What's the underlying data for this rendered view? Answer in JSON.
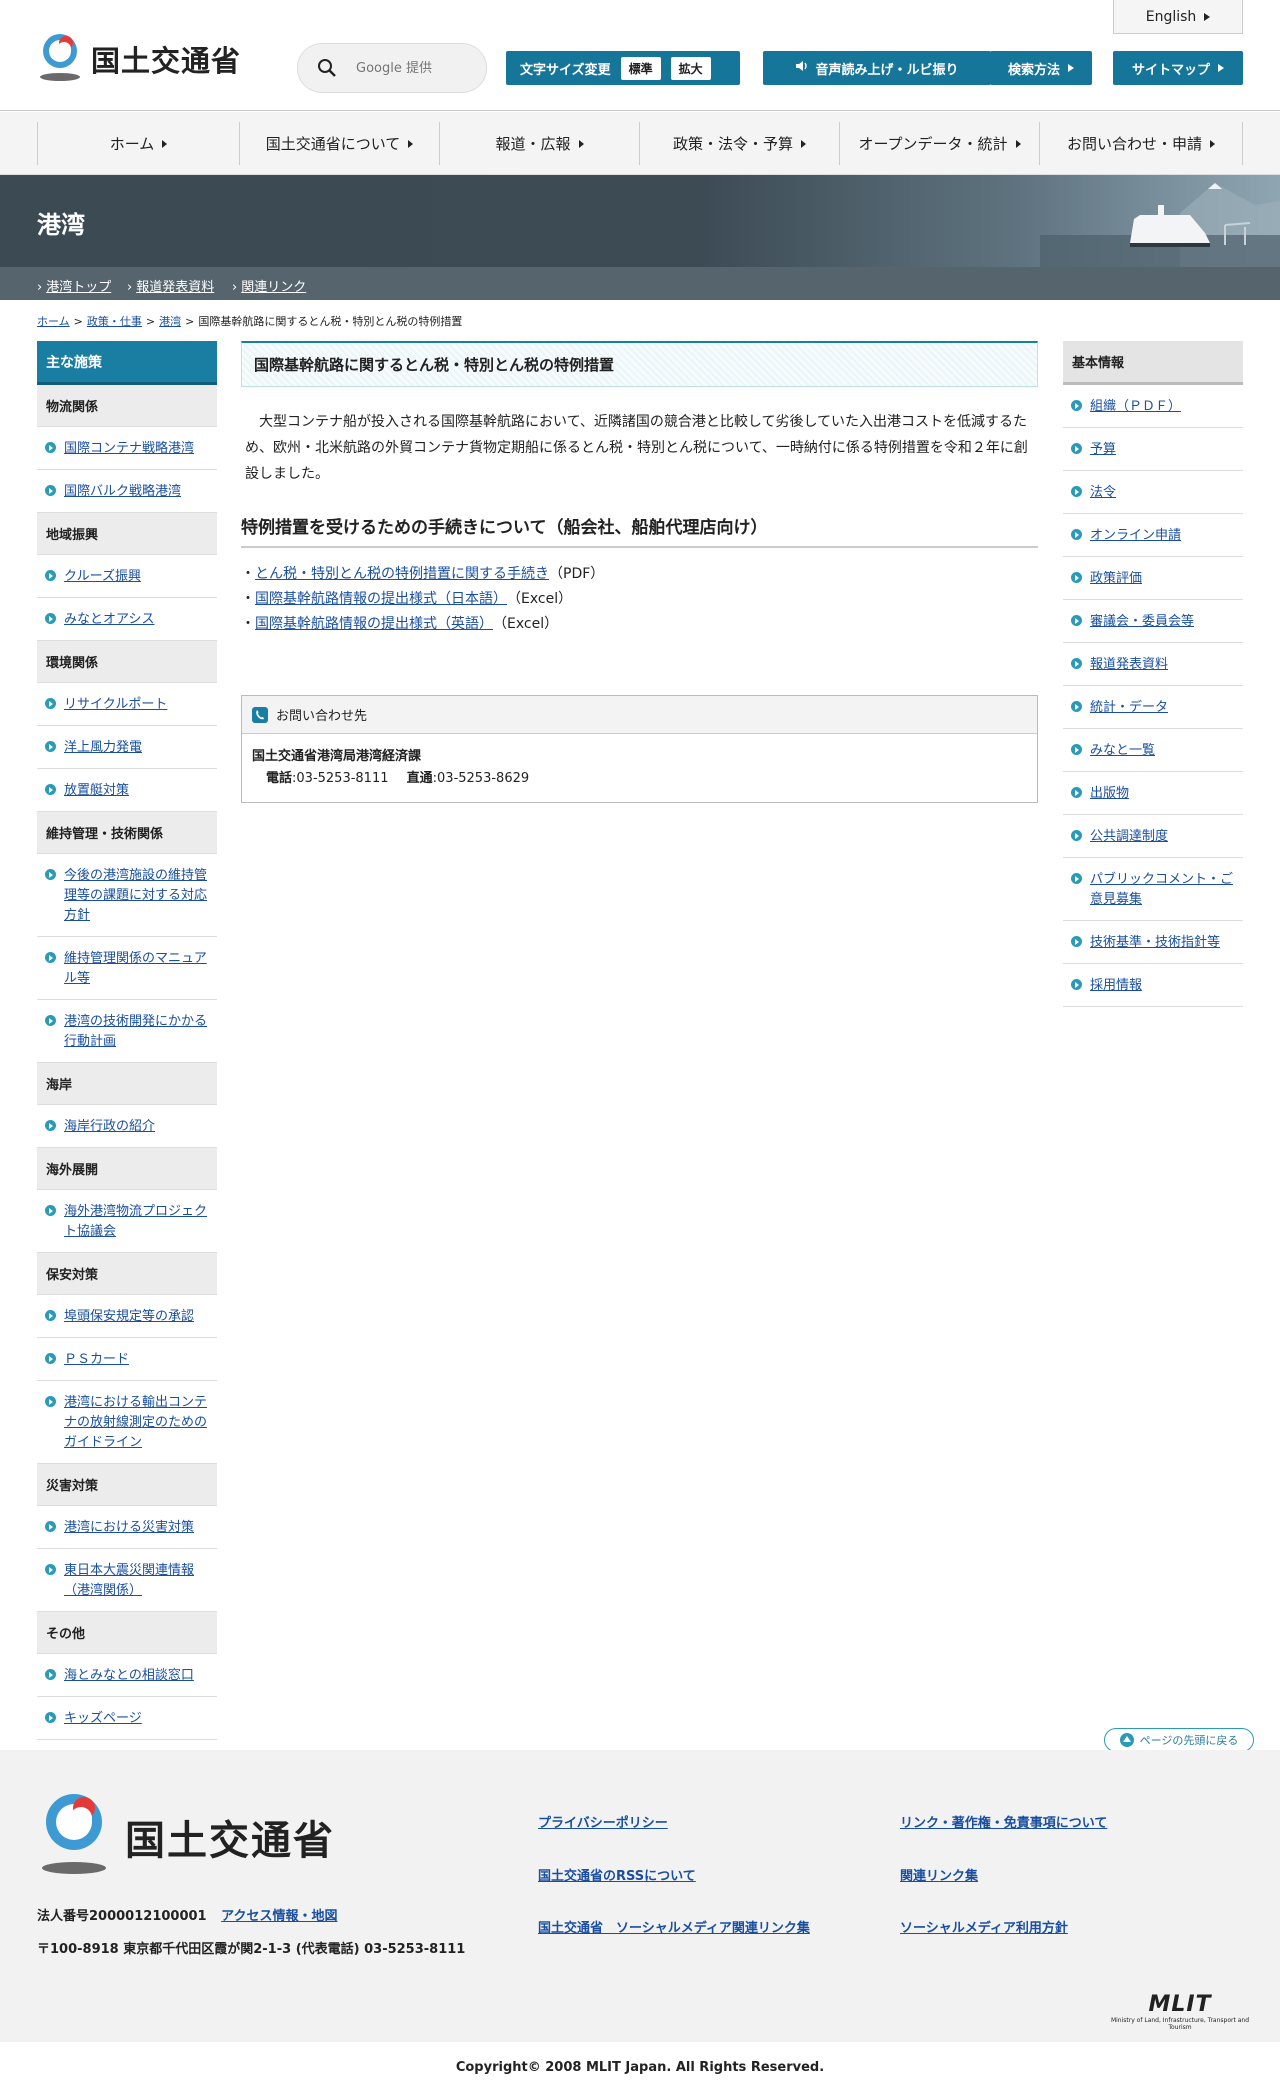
{
  "header": {
    "logo_text": "国土交通省",
    "search_placeholder": "Google 提供",
    "english_label": "English",
    "fontsize_label": "文字サイズ変更",
    "fontsize_normal": "標準",
    "fontsize_large": "拡大",
    "voice_label": "音声読み上げ・ルビ振り",
    "search_method_label": "検索方法",
    "sitemap_label": "サイトマップ"
  },
  "gnav": [
    "ホーム",
    "国土交通省について",
    "報道・広報",
    "政策・法令・予算",
    "オープンデータ・統計",
    "お問い合わせ・申請"
  ],
  "banner": {
    "title": "港湾"
  },
  "subnav": [
    "港湾トップ",
    "報道発表資料",
    "関連リンク"
  ],
  "breadcrumb": [
    "ホーム",
    "政策・仕事",
    "港湾",
    "国際基幹航路に関するとん税・特別とん税の特例措置"
  ],
  "leftnav": {
    "head": "主な施策",
    "c1": "物流関係",
    "c1_items": [
      "国際コンテナ戦略港湾",
      "国際バルク戦略港湾"
    ],
    "c2": "地域振興",
    "c2_items": [
      "クルーズ振興",
      "みなとオアシス"
    ],
    "c3": "環境関係",
    "c3_items": [
      "リサイクルポート",
      "洋上風力発電",
      "放置艇対策"
    ],
    "c4": "維持管理・技術関係",
    "c4_items": [
      "今後の港湾施設の維持管理等の課題に対する対応方針",
      "維持管理関係のマニュアル等",
      "港湾の技術開発にかかる行動計画"
    ],
    "c5": "海岸",
    "c5_items": [
      "海岸行政の紹介"
    ],
    "c6": "海外展開",
    "c6_items": [
      "海外港湾物流プロジェクト協議会"
    ],
    "c7": "保安対策",
    "c7_items": [
      "埠頭保安規定等の承認",
      "ＰＳカード",
      "港湾における輸出コンテナの放射線測定のためのガイドライン"
    ],
    "c8": "災害対策",
    "c8_items": [
      "港湾における災害対策",
      "東日本大震災関連情報（港湾関係）"
    ],
    "c9": "その他",
    "c9_items": [
      "海とみなとの相談窓口",
      "キッズページ"
    ]
  },
  "rightnav": {
    "head": "基本情報",
    "items": [
      "組織（ＰＤＦ）",
      "予算",
      "法令",
      "オンライン申請",
      "政策評価",
      "審議会・委員会等",
      "報道発表資料",
      "統計・データ",
      "みなと一覧",
      "出版物",
      "公共調達制度",
      "パブリックコメント・ご意見募集",
      "技術基準・技術指針等",
      "採用情報"
    ]
  },
  "main": {
    "title": "国際基幹航路に関するとん税・特別とん税の特例措置",
    "lead": "大型コンテナ船が投入される国際基幹航路において、近隣諸国の競合港と比較して劣後していた入出港コストを低減するため、欧州・北米航路の外貿コンテナ貨物定期船に係るとん税・特別とん税について、一時納付に係る特例措置を令和２年に創設しました。",
    "h2": "特例措置を受けるための手続きについて（船会社、船舶代理店向け）",
    "links": [
      {
        "text": "とん税・特別とん税の特例措置に関する手続き",
        "suffix": "（PDF）"
      },
      {
        "text": "国際基幹航路情報の提出様式（日本語）",
        "suffix": "（Excel）"
      },
      {
        "text": "国際基幹航路情報の提出様式（英語）",
        "suffix": "（Excel）"
      }
    ],
    "contact_head": "お問い合わせ先",
    "contact_org": "国土交通省港湾局港湾経済課",
    "contact_tel_label": "電話",
    "contact_tel": ":03-5253-8111",
    "contact_direct_label": "直通",
    "contact_direct": ":03-5253-8629"
  },
  "pagetop": "ページの先頭に戻る",
  "footer": {
    "logo_text": "国土交通省",
    "links": [
      "プライバシーポリシー",
      "リンク・著作権・免責事項について",
      "国土交通省のRSSについて",
      "関連リンク集",
      "国土交通省　ソーシャルメディア関連リンク集",
      "ソーシャルメディア利用方針"
    ],
    "corp_no": "法人番号2000012100001",
    "access": "アクセス情報・地図",
    "address": "〒100-8918 東京都千代田区霞が関2-1-3 (代表電話) 03-5253-8111",
    "mlit": "MLIT",
    "mlit_sub": "Ministry of Land, Infrastructure, Transport and Tourism",
    "copyright": "Copyright© 2008 MLIT Japan. All Rights Reserved."
  }
}
